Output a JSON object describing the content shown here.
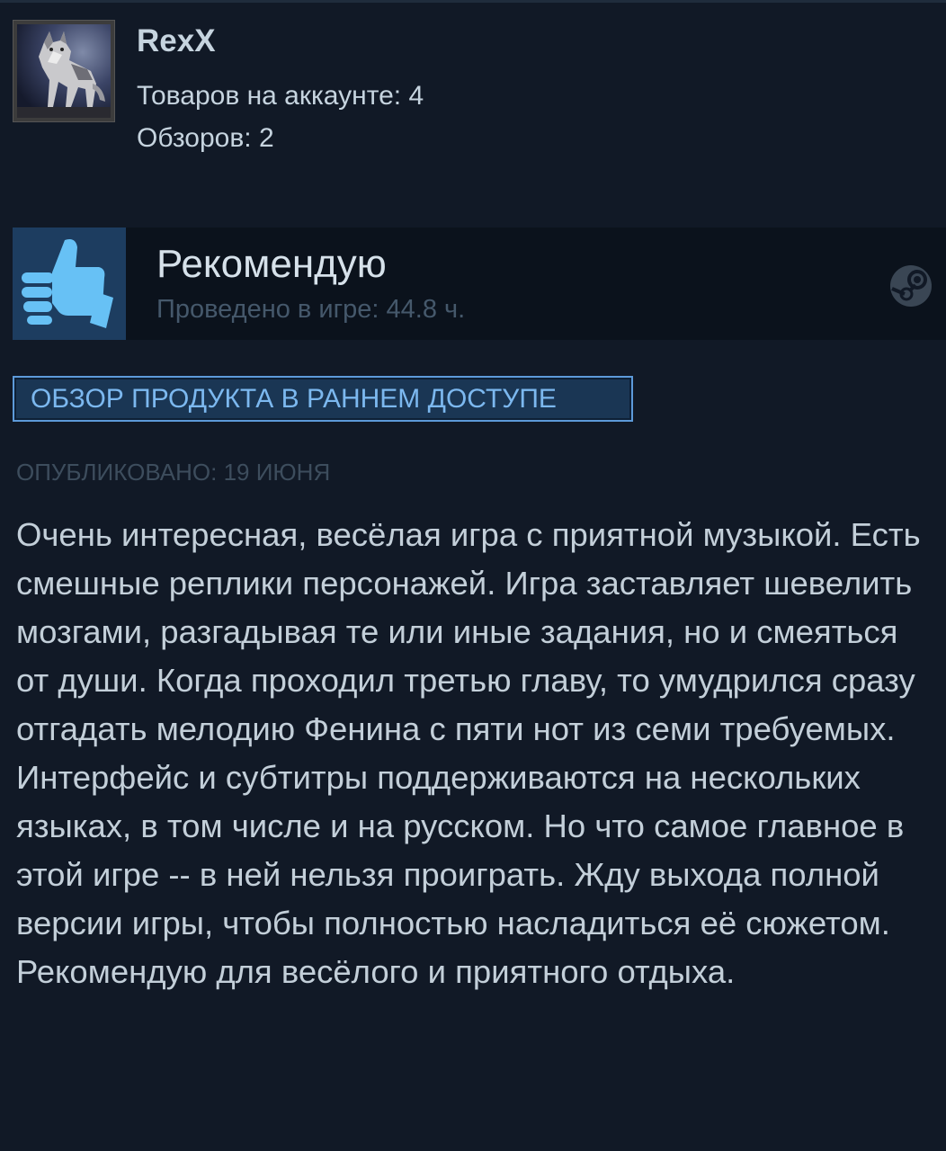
{
  "author": {
    "name": "RexX",
    "products_line": "Товаров на аккаунте: 4",
    "reviews_line": "Обзоров: 2",
    "avatar_icon": "wolf-avatar"
  },
  "recommendation": {
    "title": "Рекомендую",
    "hours": "Проведено в игре: 44.8 ч.",
    "thumb_icon": "thumbs-up-icon",
    "platform_icon": "steam-icon"
  },
  "badge": {
    "label": "ОБЗОР ПРОДУКТА В РАННЕМ ДОСТУПЕ"
  },
  "posted": "ОПУБЛИКОВАНО: 19 ИЮНЯ",
  "review": {
    "text": "Очень интересная, весёлая игра с приятной музыкой. Есть смешные реплики персонажей. Игра заставляет шевелить мозгами, разгадывая те или иные задания, но и смеяться от души. Когда проходил третью главу, то умудрился сразу отгадать мелодию Фенина с пяти нот из семи требуемых. Интерфейс и субтитры поддерживаются на нескольких языках, в том числе и на русском. Но что самое главное в этой игре -- в ней нельзя проиграть. Жду выхода полной версии игры, чтобы полностью насладиться её сюжетом. Рекомендую для весёлого и приятного отдыха."
  },
  "colors": {
    "background": "#111926",
    "badge_border": "#5d9ad9",
    "badge_text": "#7cb8ef",
    "thumb_bg": "#1d3d60",
    "thumb_fg": "#67c1f5"
  }
}
